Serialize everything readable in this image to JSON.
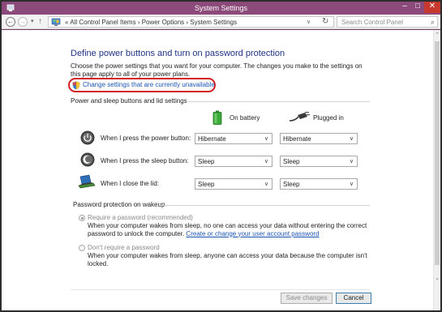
{
  "window": {
    "title": "System Settings",
    "minimize_glyph": "–",
    "maximize_glyph": "□",
    "close_glyph": "✕"
  },
  "nav": {
    "back_glyph": "←",
    "forward_glyph": "→",
    "history_glyph": "▾",
    "up_glyph": "↑",
    "breadcrumb": "«  All Control Panel Items  ›  Power Options  ›  System Settings",
    "address_chevron": "∨",
    "refresh_glyph": "↻",
    "search_placeholder": "Search Control Panel",
    "search_glyph": "⌕"
  },
  "page": {
    "heading": "Define power buttons and turn on password protection",
    "intro": "Choose the power settings that you want for your computer. The changes you make to the settings on this page apply to all of your power plans.",
    "change_settings_link": "Change settings that are currently unavailable"
  },
  "power_section": {
    "title": "Power and sleep buttons and lid settings",
    "col_battery": "On battery",
    "col_plugged": "Plugged in",
    "rows": [
      {
        "label": "When I press the power button:",
        "battery": "Hibernate",
        "plugged": "Hibernate",
        "icon": "power-icon"
      },
      {
        "label": "When I press the sleep button:",
        "battery": "Sleep",
        "plugged": "Sleep",
        "icon": "sleep-icon"
      },
      {
        "label": "When I close the lid:",
        "battery": "Sleep",
        "plugged": "Sleep",
        "icon": "laptop-lid-icon"
      }
    ],
    "dropdown_arrow": "∨"
  },
  "password_section": {
    "title": "Password protection on wakeup",
    "option_require": {
      "label": "Require a password (recommended)",
      "selected": true,
      "desc_before_link": "When your computer wakes from sleep, no one can access your data without entering the correct password to unlock the computer.",
      "link": "Create or change your user account password"
    },
    "option_none": {
      "label": "Don't require a password",
      "selected": false,
      "desc": "When your computer wakes from sleep, anyone can access your data because the computer isn't locked."
    }
  },
  "footer": {
    "save_label": "Save changes",
    "cancel_label": "Cancel"
  },
  "scrollbar": {
    "up_glyph": "⌃",
    "down_glyph": "⌄"
  },
  "colors": {
    "titlebar": "#8b4a7a",
    "heading": "#1e3287",
    "link": "#1a55b5",
    "highlight_ring": "#d32020",
    "close_button": "#c7392f"
  }
}
